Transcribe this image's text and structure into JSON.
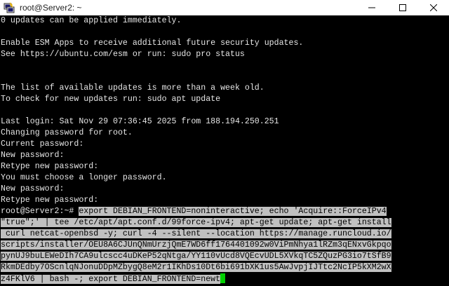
{
  "window": {
    "title": "root@Server2: ~",
    "controls": [
      "minimize",
      "maximize",
      "close"
    ]
  },
  "terminal": {
    "lines": [
      "0 updates can be applied immediately.",
      "",
      "Enable ESM Apps to receive additional future security updates.",
      "See https://ubuntu.com/esm or run: sudo pro status",
      "",
      "",
      "The list of available updates is more than a week old.",
      "To check for new updates run: sudo apt update",
      "",
      "Last login: Sat Nov 29 07:36:45 2025 from 188.194.250.251",
      "Changing password for root.",
      "Current password:",
      "New password:",
      "Retype new password:",
      "You must choose a longer password.",
      "New password:",
      "Retype new password:"
    ],
    "prompt": "root@Server2:~# ",
    "command_lines": [
      "export DEBIAN_FRONTEND=noninteractive; echo 'Acquire::ForceIPv4",
      "\"true\";' | tee /etc/apt/apt.conf.d/99force-ipv4; apt-get update; apt-get install",
      " curl netcat-openbsd -y; curl -4 --silent --location https://manage.runcloud.io/",
      "scripts/installer/OEU8A6CJUnQNmUrzjQmE7WD6ff1764401092w0ViPmNhya1lRZm3qENxvGkpqo",
      "pynUJ9buLEWeDIh7CA9ulcscc4uDKeP52qNtga/YY110vUcd8VQEcvUDL5XVkqTC5ZQuzPG3io7tSfB9",
      "RkmDEdby7OScnlqNJonuDDpMZbygQ8eM2r1IKhDs10Dt6bi691bXK1us5AwJvpjIJTtc2NcIP5kXM2wX",
      "z4FKlV6 | bash -; export DEBIAN_FRONTEND=newt"
    ]
  }
}
